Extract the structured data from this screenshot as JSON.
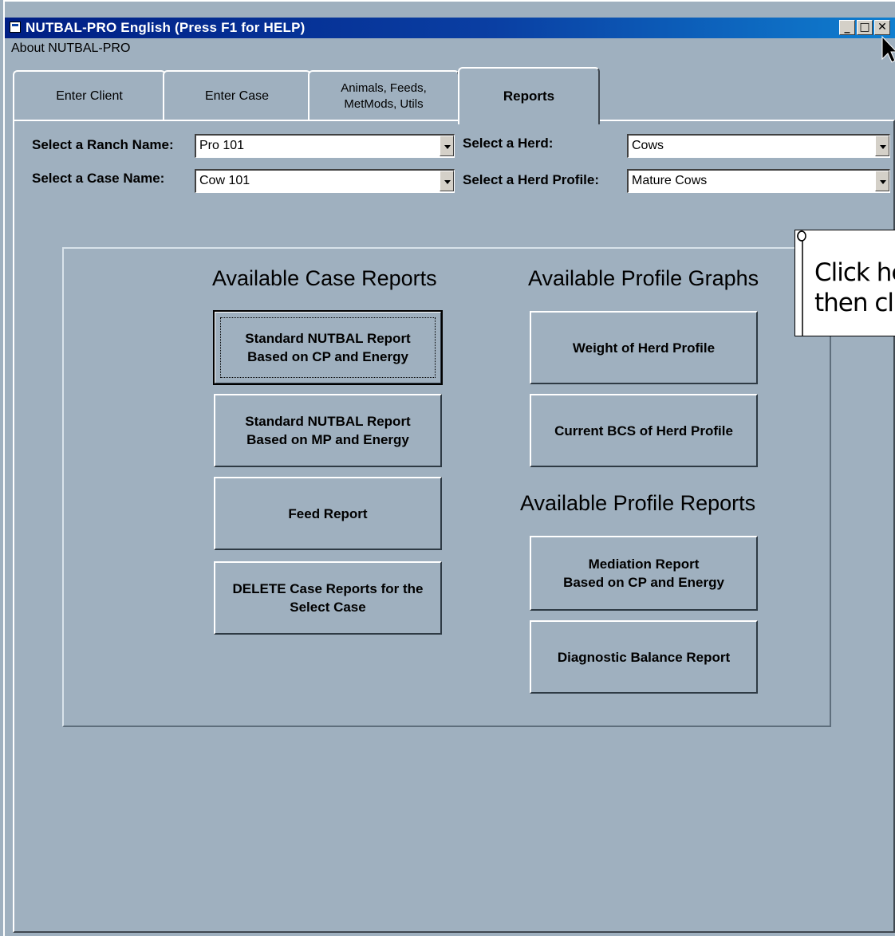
{
  "window": {
    "title": "NUTBAL-PRO English  (Press F1 for HELP)",
    "menu": {
      "about": "About NUTBAL-PRO"
    },
    "controls": {
      "minimize": "_",
      "maximize": "□",
      "close": "✕"
    }
  },
  "tabs": [
    {
      "label": "Enter Client"
    },
    {
      "label": "Enter Case"
    },
    {
      "label": "Animals, Feeds,\nMetMods, Utils"
    },
    {
      "label": "Reports",
      "active": true
    }
  ],
  "selectors": {
    "ranch_label": "Select a Ranch Name:",
    "ranch_value": "Pro 101",
    "case_label": "Select a Case Name:",
    "case_value": "Cow 101",
    "herd_label": "Select a Herd:",
    "herd_value": "Cows",
    "profile_label": "Select a Herd Profile:",
    "profile_value": "Mature Cows"
  },
  "case_reports": {
    "heading": "Available Case Reports",
    "buttons": [
      "Standard NUTBAL Report\nBased on CP and Energy",
      "Standard NUTBAL Report\nBased on MP and Energy",
      "Feed Report",
      "DELETE Case Reports for the\nSelect Case"
    ]
  },
  "profile_graphs": {
    "heading": "Available Profile Graphs",
    "buttons": [
      "Weight of Herd Profile",
      "Current BCS of Herd Profile"
    ]
  },
  "profile_reports": {
    "heading": "Available Profile Reports",
    "buttons": [
      "Mediation Report\nBased on CP and Energy",
      "Diagnostic Balance Report"
    ]
  },
  "callout": {
    "line1": "Click he",
    "line2": "then cl"
  }
}
